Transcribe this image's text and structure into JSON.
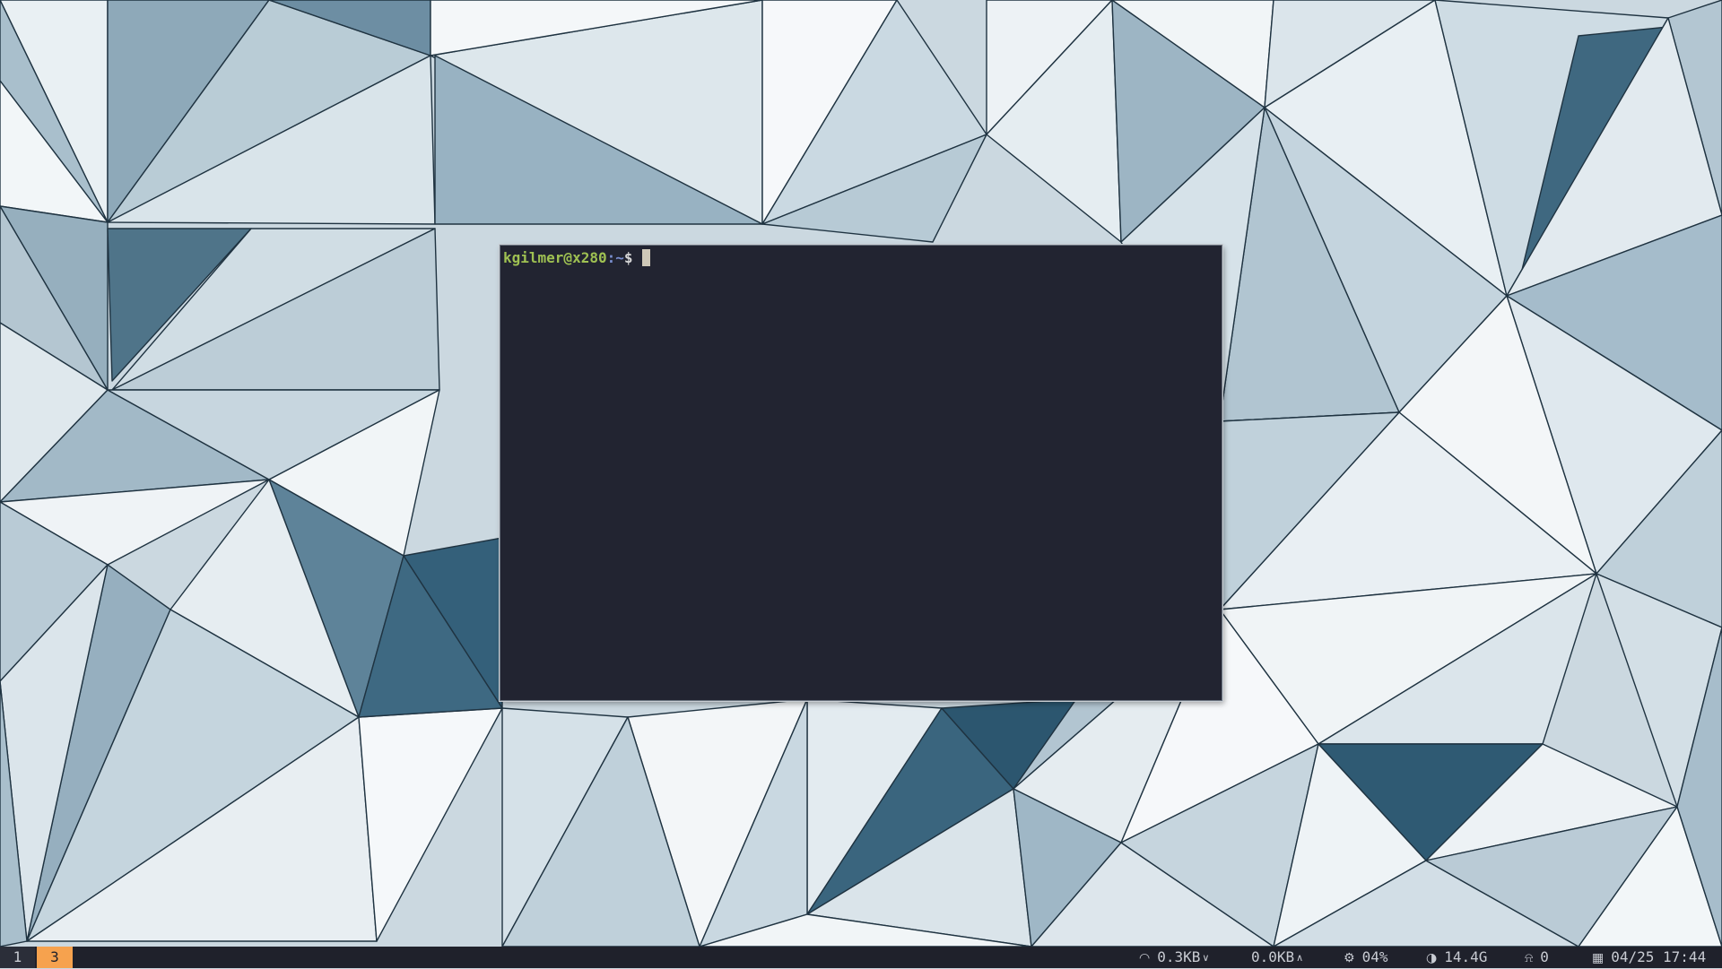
{
  "terminal": {
    "prompt_user_host": "kgilmer@x280",
    "prompt_path": ":~",
    "prompt_symbol": "$"
  },
  "workspaces": [
    {
      "label": "1",
      "active": false
    },
    {
      "label": "3",
      "active": true
    }
  ],
  "status": {
    "wifi_icon": "wifi-icon",
    "net_down": "0.3KB",
    "net_down_icon": "chevron-down-icon",
    "net_up": "0.0KB",
    "net_up_icon": "chevron-up-icon",
    "cpu_icon": "cpu-icon",
    "cpu": "04%",
    "disk_icon": "disk-icon",
    "disk": "14.4G",
    "notif_icon": "bell-icon",
    "notifications": "0",
    "calendar_icon": "calendar-icon",
    "datetime": "04/25 17:44"
  },
  "colors": {
    "bar_bg": "#1f212b",
    "active_workspace": "#f6a24e",
    "terminal_bg": "#222431",
    "prompt_user": "#9fc152",
    "prompt_path": "#7a8fd0"
  }
}
